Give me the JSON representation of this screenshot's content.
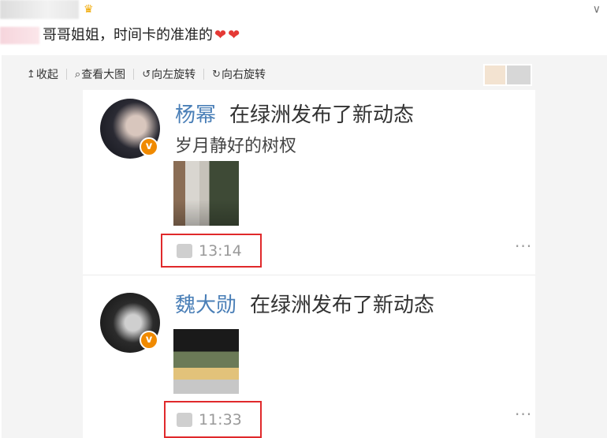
{
  "post": {
    "text": "哥哥姐姐，时间卡的准准的",
    "hearts": [
      "❤",
      "❤"
    ]
  },
  "toolbar": {
    "collapse": {
      "icon": "↥",
      "label": "收起"
    },
    "view_large": {
      "icon": "⌕",
      "label": "查看大图"
    },
    "rotate_left": {
      "icon": "↺",
      "label": "向左旋转"
    },
    "rotate_right": {
      "icon": "↻",
      "label": "向右旋转"
    }
  },
  "feed": [
    {
      "name": "杨幂",
      "action": "在绿洲发布了新动态",
      "caption": "岁月静好的树杈",
      "time": "13:14",
      "more": "···"
    },
    {
      "name": "魏大勋",
      "action": "在绿洲发布了新动态",
      "caption": "",
      "time": "11:33",
      "more": "···"
    }
  ],
  "icons": {
    "crown": "♛",
    "verified": "v",
    "caret": "∨"
  },
  "colors": {
    "highlight_box": "#e0292b",
    "name_link": "#4a7fb7",
    "verified_badge": "#f08a00"
  }
}
